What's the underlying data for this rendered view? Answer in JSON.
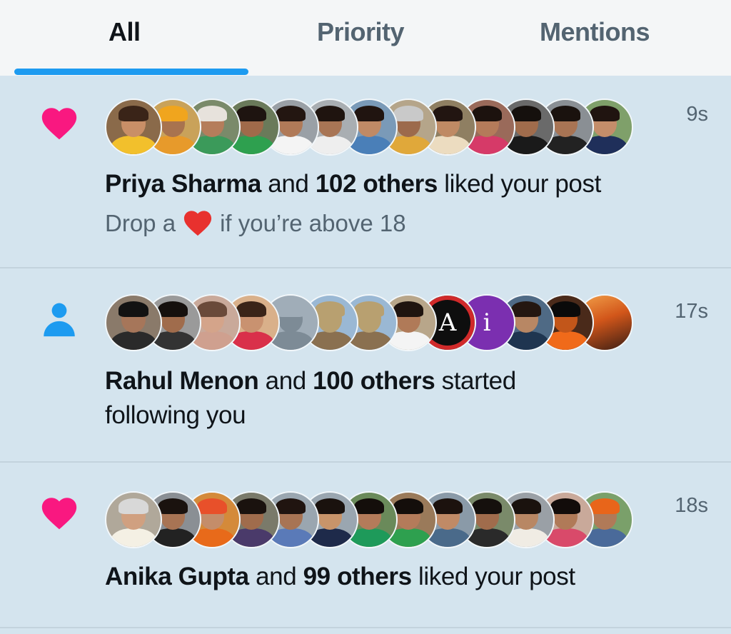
{
  "tabs": [
    {
      "label": "All",
      "active": true
    },
    {
      "label": "Priority",
      "active": false
    },
    {
      "label": "Mentions",
      "active": false
    }
  ],
  "colors": {
    "accent": "#1d9bf0",
    "like": "#f91880",
    "follow": "#1d9bf0",
    "background": "#d4e4ee"
  },
  "notifications": [
    {
      "type": "like",
      "icon": "heart-icon",
      "time": "9s",
      "actor": "Priya Sharma",
      "conj": "and",
      "count": "102 others",
      "action": "liked your post",
      "post_prefix": "Drop a",
      "post_suffix": "if you’re above 18",
      "avatar_count": 13
    },
    {
      "type": "follow",
      "icon": "person-icon",
      "time": "17s",
      "actor": "Rahul Menon",
      "conj": "and",
      "count": "100 others",
      "action": "started",
      "action2": "following you",
      "avatar_count": 13
    },
    {
      "type": "like",
      "icon": "heart-icon",
      "time": "18s",
      "actor": "Anika Gupta",
      "conj": "and",
      "count": "99 others",
      "action": "liked your post",
      "avatar_count": 13
    }
  ]
}
